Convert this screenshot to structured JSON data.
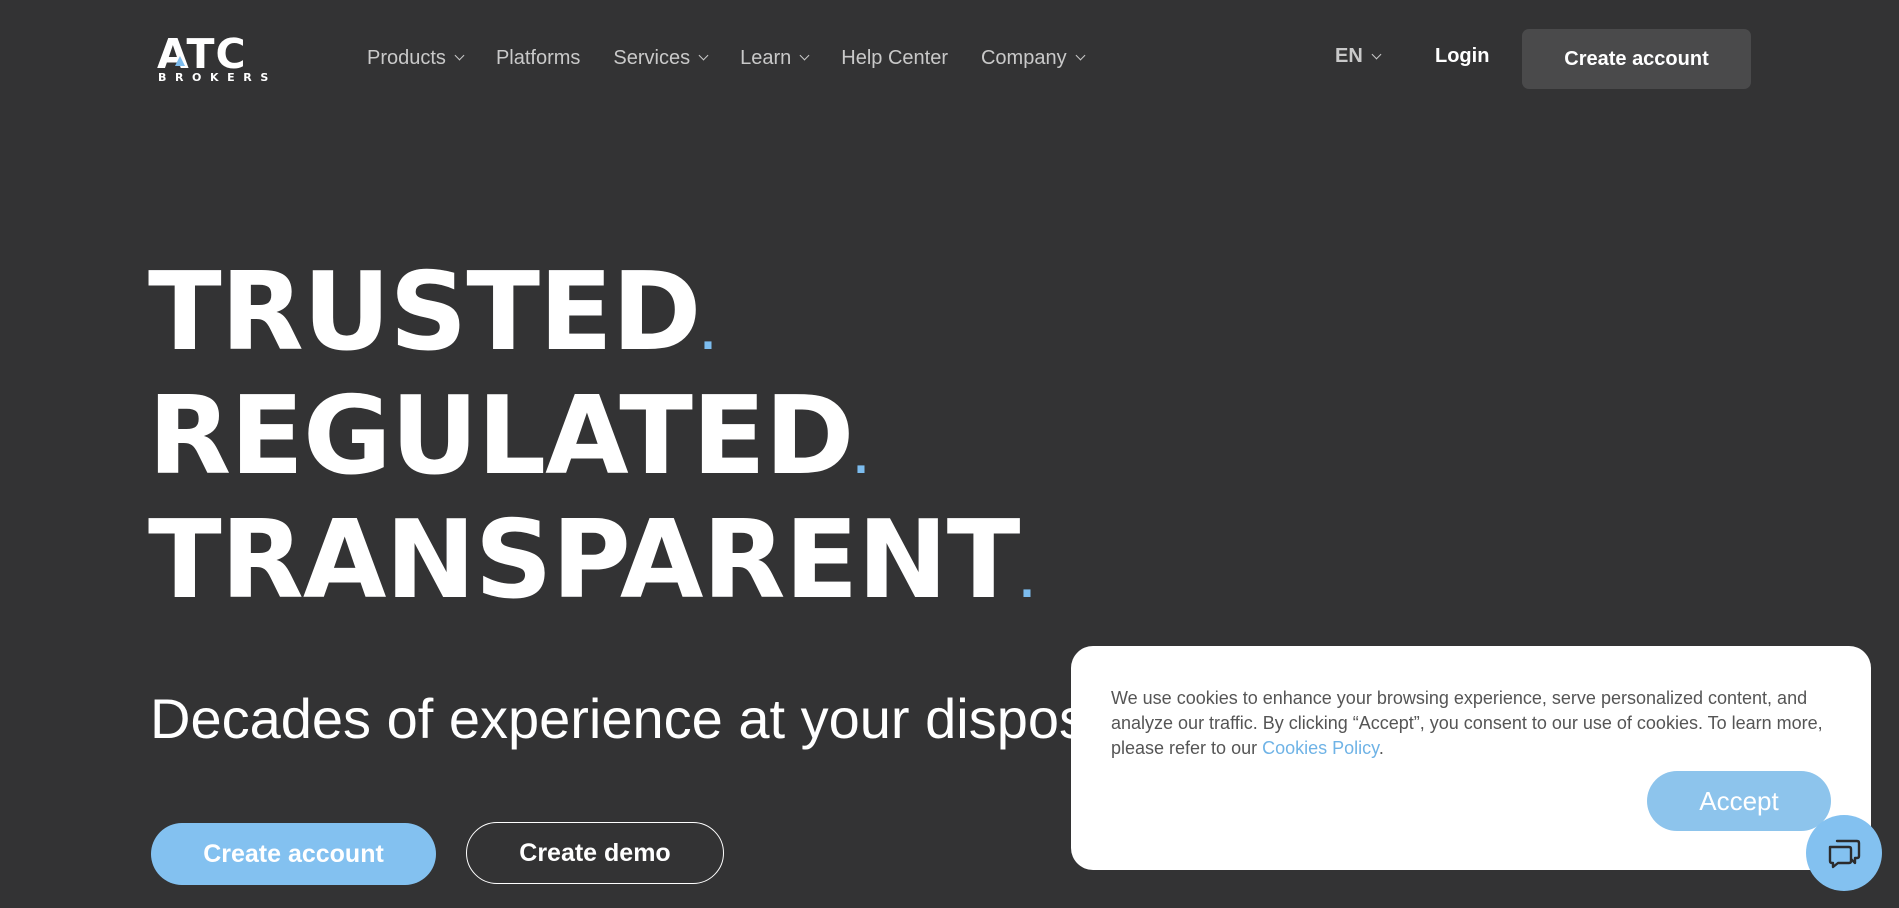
{
  "header": {
    "logo_text": "ATC",
    "logo_subtext": "BROKERS",
    "nav": [
      {
        "label": "Products",
        "dropdown": true
      },
      {
        "label": "Platforms",
        "dropdown": false
      },
      {
        "label": "Services",
        "dropdown": true
      },
      {
        "label": "Learn",
        "dropdown": true
      },
      {
        "label": "Help Center",
        "dropdown": false
      },
      {
        "label": "Company",
        "dropdown": true
      }
    ],
    "language": "EN",
    "login_label": "Login",
    "create_account_label": "Create account"
  },
  "hero": {
    "line1": "TRUSTED",
    "line2": "REGULATED",
    "line3": "TRANSPARENT",
    "dot": ".",
    "subtitle": "Decades of experience at your disposal",
    "primary_cta": "Create account",
    "secondary_cta": "Create demo"
  },
  "cookie_banner": {
    "text_before_link": "We use cookies to enhance your browsing experience, serve personalized content, and analyze our traffic. By clicking “Accept”, you consent to our use of cookies. To learn more, please refer to our ",
    "link_label": "Cookies Policy",
    "text_after_link": ".",
    "accept_label": "Accept"
  },
  "colors": {
    "background": "#333334",
    "accent": "#83c1f0",
    "header_button": "#4a4a4b"
  },
  "icons": {
    "chat": "chat-bubbles-icon"
  }
}
